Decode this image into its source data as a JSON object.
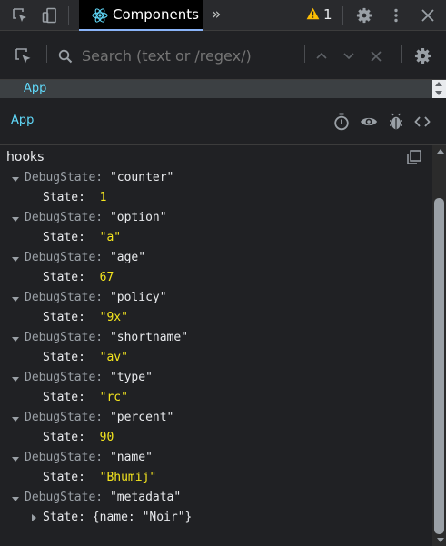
{
  "toolbar": {
    "active_tab_label": "Components",
    "warning_count": "1",
    "icons": [
      "inspect-element-icon",
      "device-toggle-icon",
      "react-icon",
      "more-tabs-icon",
      "warning-icon",
      "settings-icon",
      "kebab-menu-icon",
      "close-icon"
    ]
  },
  "search": {
    "placeholder": "Search (text or /regex/)",
    "icons": [
      "select-element-icon",
      "search-icon",
      "previous-result-icon",
      "next-result-icon",
      "clear-search-icon",
      "settings-icon"
    ]
  },
  "breadcrumb": {
    "item": "App"
  },
  "inspected": {
    "component_name": "App",
    "icons": [
      "suspend-icon",
      "inspect-dom-icon",
      "log-to-console-icon",
      "view-source-icon"
    ]
  },
  "hooks": {
    "title": "hooks",
    "items": [
      {
        "hook": "DebugState",
        "name": "\"counter\"",
        "state_label": "State:",
        "value": "1"
      },
      {
        "hook": "DebugState",
        "name": "\"option\"",
        "state_label": "State:",
        "value": "\"a\""
      },
      {
        "hook": "DebugState",
        "name": "\"age\"",
        "state_label": "State:",
        "value": "67"
      },
      {
        "hook": "DebugState",
        "name": "\"policy\"",
        "state_label": "State:",
        "value": "\"9x\""
      },
      {
        "hook": "DebugState",
        "name": "\"shortname\"",
        "state_label": "State:",
        "value": "\"av\""
      },
      {
        "hook": "DebugState",
        "name": "\"type\"",
        "state_label": "State:",
        "value": "\"rc\""
      },
      {
        "hook": "DebugState",
        "name": "\"percent\"",
        "state_label": "State:",
        "value": "90"
      },
      {
        "hook": "DebugState",
        "name": "\"name\"",
        "state_label": "State:",
        "value": "\"Bhumij\""
      },
      {
        "hook": "DebugState",
        "name": "\"metadata\"",
        "state_label": "State:",
        "value": "{name: \"Noir\"}"
      }
    ]
  },
  "colors": {
    "accent": "#61dafb",
    "value": "#f4e51f",
    "warning": "#fbbc04",
    "background": "#202124"
  }
}
